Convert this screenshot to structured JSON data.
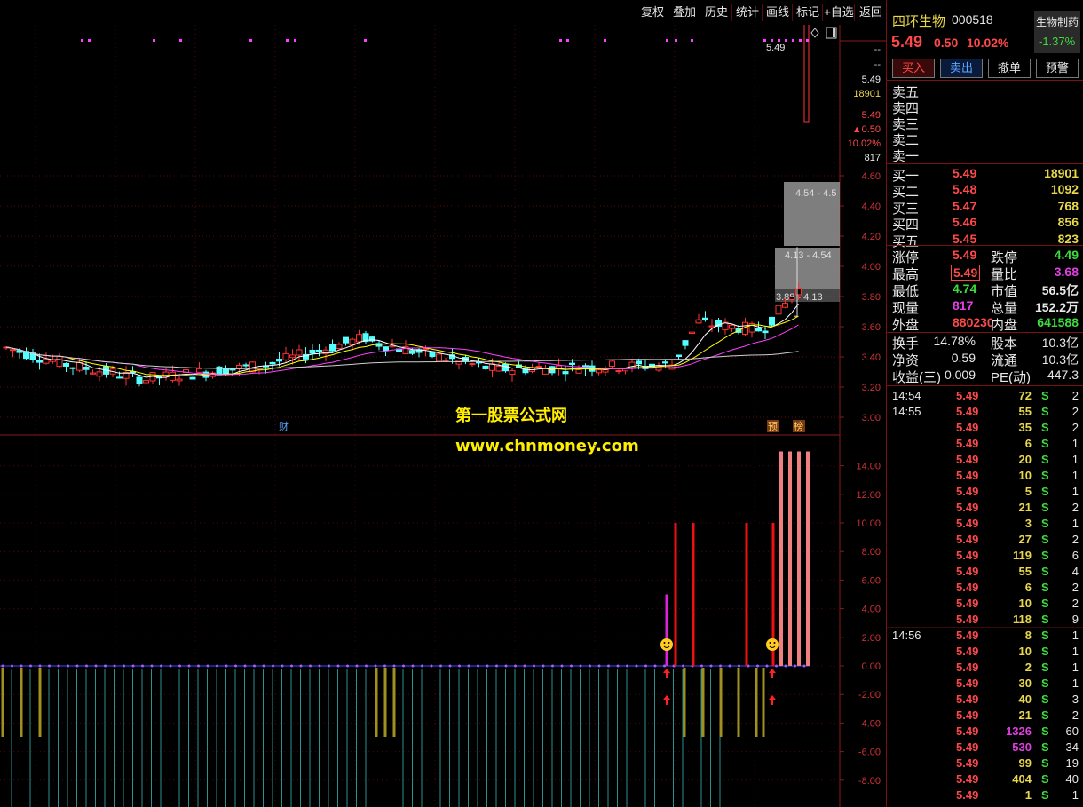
{
  "toolbar": {
    "buttons": [
      "复权",
      "叠加",
      "历史",
      "统计",
      "画线",
      "标记",
      "+自选",
      "返回"
    ]
  },
  "chart": {
    "price_axis": [
      "4.60",
      "4.40",
      "4.20",
      "4.00",
      "3.80",
      "3.60",
      "3.40",
      "3.20",
      "3.00"
    ],
    "price_box": [
      "--",
      "--",
      "5.49",
      "18901",
      "5.49",
      "▲0.50",
      "10.02%",
      "817"
    ],
    "last_price_label": "5.49",
    "chip_labels": [
      "4.54 - 4.5",
      "4.13 - 4.54",
      "3.88 - 4.13"
    ],
    "markers": {
      "cai": "财",
      "yu": "预",
      "bang": "榜"
    },
    "watermark_title": "第一股票公式网",
    "watermark_url": "www.chnmoney.com",
    "indicator_axis": [
      "14.00",
      "12.00",
      "10.00",
      "8.00",
      "6.00",
      "4.00",
      "2.00",
      "0.00",
      "-2.00",
      "-4.00",
      "-6.00",
      "-8.00"
    ],
    "colors": {
      "candle_up": "#ff3232",
      "candle_down": "#54ffff",
      "ma5": "#ffffff",
      "ma10": "#ffff00",
      "ma20": "#ff40ff",
      "ma60": "#d0d0d0"
    }
  },
  "stock": {
    "name": "四环生物",
    "code": "000518",
    "price": "5.49",
    "change": "0.50",
    "change_pct": "10.02%",
    "sector_name": "生物制药",
    "sector_change": "-1.37%"
  },
  "actions": [
    "买入",
    "卖出",
    "撤单",
    "预警"
  ],
  "sell_orders": [
    {
      "label": "卖五",
      "price": "",
      "vol": ""
    },
    {
      "label": "卖四",
      "price": "",
      "vol": ""
    },
    {
      "label": "卖三",
      "price": "",
      "vol": ""
    },
    {
      "label": "卖二",
      "price": "",
      "vol": ""
    },
    {
      "label": "卖一",
      "price": "",
      "vol": ""
    }
  ],
  "buy_orders": [
    {
      "label": "买一",
      "price": "5.49",
      "vol": "18901"
    },
    {
      "label": "买二",
      "price": "5.48",
      "vol": "1092"
    },
    {
      "label": "买三",
      "price": "5.47",
      "vol": "768"
    },
    {
      "label": "买四",
      "price": "5.46",
      "vol": "856"
    },
    {
      "label": "买五",
      "price": "5.45",
      "vol": "823"
    }
  ],
  "stats": [
    {
      "l1": "涨停",
      "v1": "5.49",
      "l2": "跌停",
      "v2": "4.49"
    },
    {
      "l1": "最高",
      "v1": "5.49",
      "l2": "量比",
      "v2": "3.68"
    },
    {
      "l1": "最低",
      "v1": "4.74",
      "l2": "市值",
      "v2": "56.5亿"
    },
    {
      "l1": "现量",
      "v1": "817",
      "l2": "总量",
      "v2": "152.2万"
    },
    {
      "l1": "外盘",
      "v1": "880230",
      "l2": "内盘",
      "v2": "641588"
    }
  ],
  "fundamentals": [
    {
      "l1": "换手",
      "v1": "14.78%",
      "l2": "股本",
      "v2": "10.3亿"
    },
    {
      "l1": "净资",
      "v1": "0.59",
      "l2": "流通",
      "v2": "10.3亿"
    },
    {
      "l1": "收益(三)",
      "v1": "0.009",
      "l2": "PE(动)",
      "v2": "447.3"
    }
  ],
  "ticks": [
    {
      "time": "14:54",
      "price": "5.49",
      "vol": "72",
      "side": "S",
      "n": "2"
    },
    {
      "time": "14:55",
      "price": "5.49",
      "vol": "55",
      "side": "S",
      "n": "2"
    },
    {
      "time": "",
      "price": "5.49",
      "vol": "35",
      "side": "S",
      "n": "2"
    },
    {
      "time": "",
      "price": "5.49",
      "vol": "6",
      "side": "S",
      "n": "1"
    },
    {
      "time": "",
      "price": "5.49",
      "vol": "20",
      "side": "S",
      "n": "1"
    },
    {
      "time": "",
      "price": "5.49",
      "vol": "10",
      "side": "S",
      "n": "1"
    },
    {
      "time": "",
      "price": "5.49",
      "vol": "5",
      "side": "S",
      "n": "1"
    },
    {
      "time": "",
      "price": "5.49",
      "vol": "21",
      "side": "S",
      "n": "2"
    },
    {
      "time": "",
      "price": "5.49",
      "vol": "3",
      "side": "S",
      "n": "1"
    },
    {
      "time": "",
      "price": "5.49",
      "vol": "27",
      "side": "S",
      "n": "2"
    },
    {
      "time": "",
      "price": "5.49",
      "vol": "119",
      "side": "S",
      "n": "6"
    },
    {
      "time": "",
      "price": "5.49",
      "vol": "55",
      "side": "S",
      "n": "4"
    },
    {
      "time": "",
      "price": "5.49",
      "vol": "6",
      "side": "S",
      "n": "2"
    },
    {
      "time": "",
      "price": "5.49",
      "vol": "10",
      "side": "S",
      "n": "2"
    },
    {
      "time": "",
      "price": "5.49",
      "vol": "118",
      "side": "S",
      "n": "9"
    },
    {
      "time": "14:56",
      "price": "5.49",
      "vol": "8",
      "side": "S",
      "n": "1"
    },
    {
      "time": "",
      "price": "5.49",
      "vol": "10",
      "side": "S",
      "n": "1"
    },
    {
      "time": "",
      "price": "5.49",
      "vol": "2",
      "side": "S",
      "n": "1"
    },
    {
      "time": "",
      "price": "5.49",
      "vol": "30",
      "side": "S",
      "n": "1"
    },
    {
      "time": "",
      "price": "5.49",
      "vol": "40",
      "side": "S",
      "n": "3"
    },
    {
      "time": "",
      "price": "5.49",
      "vol": "21",
      "side": "S",
      "n": "2"
    },
    {
      "time": "",
      "price": "5.49",
      "vol": "1326",
      "side": "S",
      "n": "60"
    },
    {
      "time": "",
      "price": "5.49",
      "vol": "530",
      "side": "S",
      "n": "34"
    },
    {
      "time": "",
      "price": "5.49",
      "vol": "99",
      "side": "S",
      "n": "19"
    },
    {
      "time": "",
      "price": "5.49",
      "vol": "404",
      "side": "S",
      "n": "40"
    },
    {
      "time": "",
      "price": "5.49",
      "vol": "1",
      "side": "S",
      "n": "1"
    }
  ]
}
